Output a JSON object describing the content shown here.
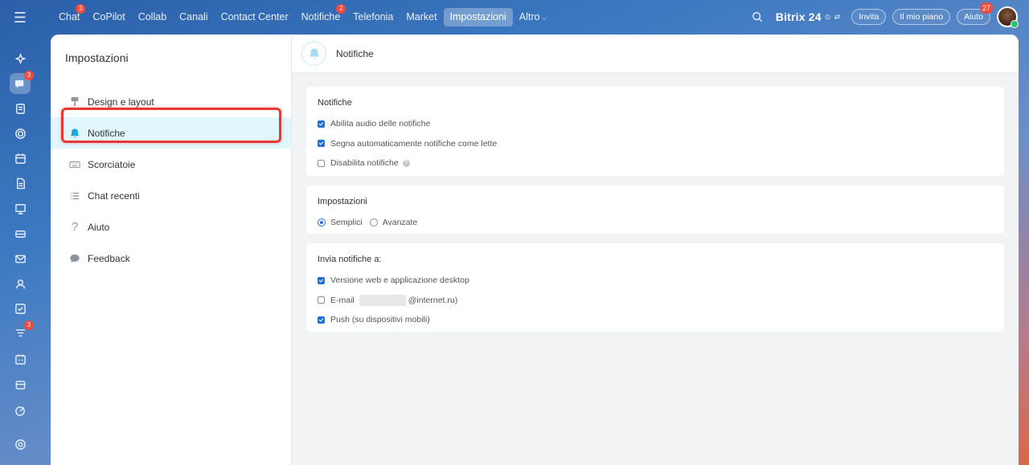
{
  "topnav": {
    "items": [
      {
        "label": "Chat",
        "badge": "3"
      },
      {
        "label": "CoPilot",
        "badge": ""
      },
      {
        "label": "Collab",
        "badge": ""
      },
      {
        "label": "Canali",
        "badge": ""
      },
      {
        "label": "Contact Center",
        "badge": ""
      },
      {
        "label": "Notifiche",
        "badge": "2"
      },
      {
        "label": "Telefonia",
        "badge": ""
      },
      {
        "label": "Market",
        "badge": ""
      },
      {
        "label": "Impostazioni",
        "badge": "",
        "active": true
      },
      {
        "label": "Altro",
        "badge": ""
      }
    ],
    "logo": "Bitrix",
    "logo_num": "24",
    "invite_label": "Invita",
    "plan_label": "Il mio piano",
    "help_label": "Aiuto",
    "help_badge": "27"
  },
  "rail": {
    "chat_badge": "3",
    "feed_badge": "3"
  },
  "sidebar": {
    "title": "Impostazioni",
    "items": [
      {
        "label": "Design e layout",
        "icon": "brush-icon"
      },
      {
        "label": "Notifiche",
        "icon": "bell-icon",
        "active": true
      },
      {
        "label": "Scorciatoie",
        "icon": "keyboard-icon"
      },
      {
        "label": "Chat recenti",
        "icon": "list-icon"
      },
      {
        "label": "Aiuto",
        "icon": "question-icon"
      },
      {
        "label": "Feedback",
        "icon": "speech-bubble-icon"
      }
    ]
  },
  "content": {
    "title": "Notifiche",
    "sections": {
      "notifiche": {
        "title": "Notifiche",
        "options": [
          {
            "label": "Abilita audio delle notifiche",
            "checked": true
          },
          {
            "label": "Segna automaticamente notifiche come lette",
            "checked": true
          },
          {
            "label": "Disabilita notifiche",
            "checked": false
          }
        ]
      },
      "impostazioni": {
        "title": "Impostazioni",
        "radio": [
          {
            "label": "Semplici",
            "selected": true
          },
          {
            "label": "Avanzate",
            "selected": false
          }
        ]
      },
      "invia": {
        "title": "Invia notifiche a:",
        "options": [
          {
            "label": "Versione web e applicazione desktop",
            "checked": true
          },
          {
            "label": "E-mail",
            "checked": false,
            "suffix": "@internet.ru)"
          },
          {
            "label": "Push (su dispositivi mobili)",
            "checked": true
          }
        ]
      }
    }
  },
  "colors": {
    "accent": "#1f6fe0",
    "highlight": "#e53935",
    "active_bg": "#e1f6fd",
    "badge": "#ef4b3f"
  }
}
